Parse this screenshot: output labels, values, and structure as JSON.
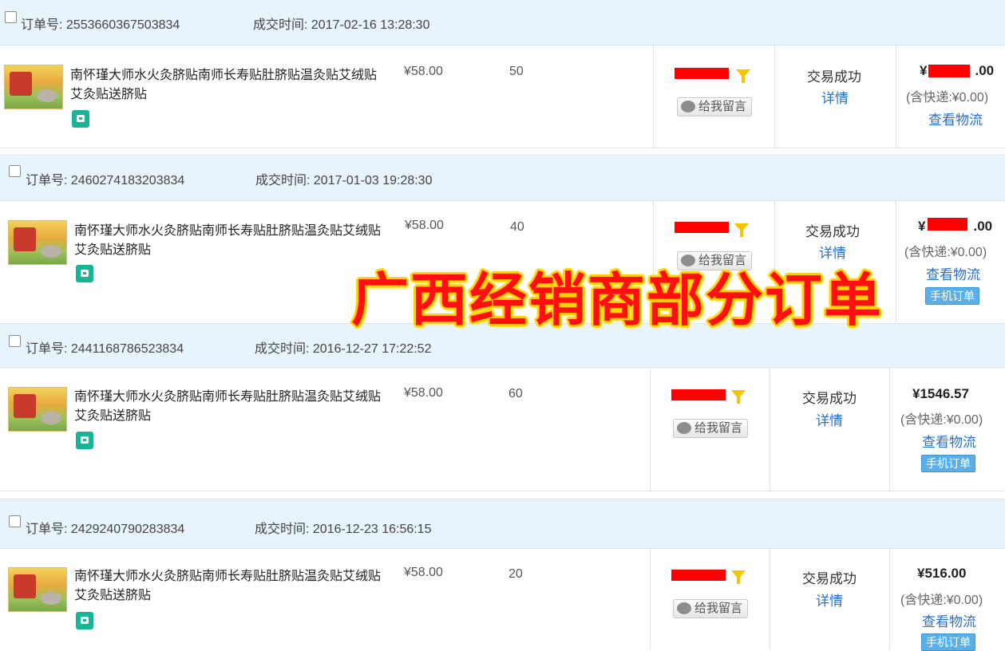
{
  "orders": [
    {
      "order_label": "订单号:",
      "order_no": "2553660367503834",
      "time_label": "成交时间:",
      "time": "2017-02-16 13:28:30",
      "product": "南怀瑾大师水火灸脐贴南师长寿贴肚脐贴温灸贴艾绒贴艾灸贴送脐贴",
      "price": "¥58.00",
      "qty": "50",
      "message_button": "给我留言",
      "status": "交易成功",
      "detail_link": "详情",
      "total_prefix": "¥",
      "total_suffix": ".00",
      "shipping": "(含快递:¥0.00)",
      "logistics_link": "查看物流"
    },
    {
      "order_label": "订单号:",
      "order_no": "2460274183203834",
      "time_label": "成交时间:",
      "time": "2017-01-03 19:28:30",
      "product": "南怀瑾大师水火灸脐贴南师长寿贴肚脐贴温灸贴艾绒贴艾灸贴送脐贴",
      "price": "¥58.00",
      "qty": "40",
      "message_button": "给我留言",
      "status": "交易成功",
      "detail_link": "详情",
      "total_prefix": "¥",
      "total_suffix": ".00",
      "shipping": "(含快递:¥0.00)",
      "logistics_link": "查看物流",
      "mobile_tag": "手机订单"
    },
    {
      "order_label": "订单号:",
      "order_no": "2441168786523834",
      "time_label": "成交时间:",
      "time": "2016-12-27 17:22:52",
      "product": "南怀瑾大师水火灸脐贴南师长寿贴肚脐贴温灸贴艾绒贴艾灸贴送脐贴",
      "price": "¥58.00",
      "qty": "60",
      "message_button": "给我留言",
      "status": "交易成功",
      "detail_link": "详情",
      "total": "¥1546.57",
      "shipping": "(含快递:¥0.00)",
      "logistics_link": "查看物流",
      "mobile_tag": "手机订单"
    },
    {
      "order_label": "订单号:",
      "order_no": "2429240790283834",
      "time_label": "成交时间:",
      "time": "2016-12-23 16:56:15",
      "product": "南怀瑾大师水火灸脐贴南师长寿贴肚脐贴温灸贴艾绒贴艾灸贴送脐贴",
      "price": "¥58.00",
      "qty": "20",
      "message_button": "给我留言",
      "status": "交易成功",
      "detail_link": "详情",
      "total": "¥516.00",
      "shipping": "(含快递:¥0.00)",
      "logistics_link": "查看物流",
      "mobile_tag": "手机订单"
    }
  ],
  "overlay_caption": "广西经销商部分订单",
  "colors": {
    "header_bg": "#e8f4fb",
    "link": "#2a6fc9",
    "redaction": "#ff0000",
    "overlay_text": "#ff1010",
    "overlay_outline": "#ffd200"
  },
  "icons": [
    "checkbox-icon",
    "product-thumbnail",
    "mobile-badge-icon",
    "filter-funnel-icon",
    "message-bubble-icon"
  ]
}
